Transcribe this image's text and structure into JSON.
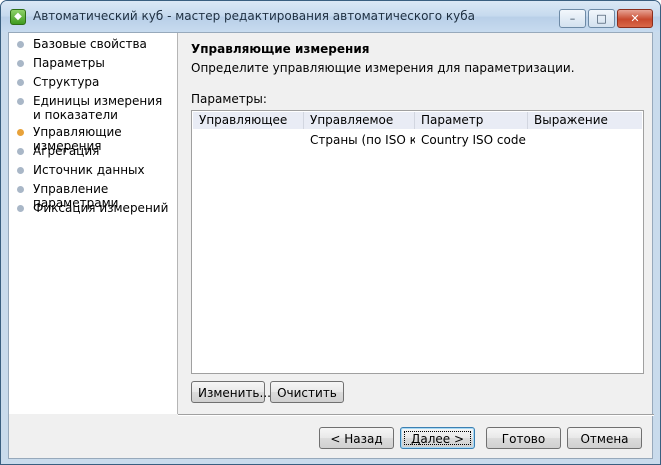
{
  "window": {
    "title": "Автоматический куб - мастер редактирования автоматического куба",
    "controls": {
      "minimize": "–",
      "maximize": "□",
      "close": "✕"
    }
  },
  "sidebar": {
    "items": [
      {
        "label": "Базовые свойства"
      },
      {
        "label": "Параметры"
      },
      {
        "label": "Структура"
      },
      {
        "label": "Единицы измерения и показатели"
      },
      {
        "label": "Управляющие измерения",
        "active": true
      },
      {
        "label": "Агрегация"
      },
      {
        "label": "Источник данных"
      },
      {
        "label": "Управление параметрами"
      },
      {
        "label": "Фиксация измерений"
      }
    ]
  },
  "page": {
    "heading": "Управляющие измерения",
    "description": "Определите управляющие измерения для параметризации.",
    "params_label": "Параметры:"
  },
  "grid": {
    "columns": [
      "Управляющее",
      "Управляемое",
      "Параметр",
      "Выражение"
    ],
    "rows": [
      [
        "",
        "Страны (по ISO ко...",
        "Country ISO code",
        ""
      ]
    ]
  },
  "grid_buttons": {
    "edit": "Изменить...",
    "clear": "Очистить"
  },
  "nav_buttons": {
    "back": "< Назад",
    "next": "Далее >",
    "finish": "Готово",
    "cancel": "Отмена"
  }
}
